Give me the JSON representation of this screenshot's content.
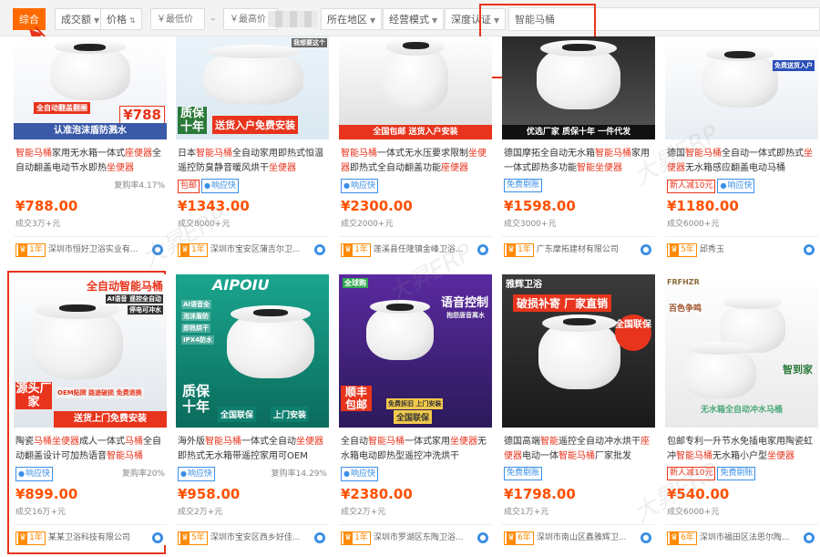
{
  "filters": {
    "sort_default": "综合",
    "sort_volume": "成交额",
    "sort_price": "价格",
    "price_min_placeholder": "￥最低价",
    "price_max_placeholder": "￥最高价",
    "region": "所在地区",
    "business_mode": "经营模式",
    "deep_verify": "深度认证",
    "search_value": "智能马桶"
  },
  "watermark": "大昇ERP",
  "colors": {
    "accent": "#ff6a00",
    "price": "#ff5000",
    "highlight_red": "#e8341c",
    "tag_blue": "#3a8ee6"
  },
  "thumbnail_text": {
    "c1": {
      "banner": "全自动翻盖翻圈",
      "price": "¥788",
      "bottom": "认准泡沫盾防溅水"
    },
    "c2": {
      "corner": "我想要这个",
      "left": "质保十年",
      "right": "送货入户免费安装"
    },
    "c3": {
      "bottom": "全国包邮 送货入户安装"
    },
    "c4": {
      "bottom": "优选厂家 质保十年 一件代发"
    },
    "c5": {
      "bottom": "免费送货入户"
    },
    "c6": {
      "top": "全自动智能马桶",
      "f1": "AI语音 遥控全自动",
      "f2": "停电可冲水",
      "left": "源头厂家",
      "strip": "OEM贴牌 路途破损 免费退换",
      "bottom": "送货上门免费安装"
    },
    "c7": {
      "brand": "AIPOIU",
      "f1": "AI语音全",
      "f2": "泡沫盾防",
      "f3": "即热烘干",
      "f4": "IPX4防水",
      "left": "质保十年",
      "b1": "全国联保",
      "b2": "上门安装"
    },
    "c8": {
      "brand": "全球购",
      "title": "语音控制",
      "sub": "抱怨唐音离水",
      "left": "顺丰包邮",
      "b1": "免费拆旧 上门安装",
      "b2": "全国联保"
    },
    "c9": {
      "brand": "雅辉卫浴",
      "title": "破损补寄 厂家直销",
      "badge": "全国联保"
    },
    "c10": {
      "brand": "FRFHZR",
      "side": "百色争鸣",
      "badge": "智到家",
      "bottom": "无水箱全自动冲水马桶"
    }
  },
  "products": [
    {
      "title_parts": [
        [
          "智能马桶",
          true
        ],
        [
          "家用无水箱一体式",
          false
        ],
        [
          "座便器",
          true
        ],
        [
          "全自动翻盖电动节水即热",
          false
        ],
        [
          "坐便器",
          true
        ]
      ],
      "tags": [],
      "rate": "复购率4.17%",
      "price": "¥788.00",
      "sold": "成交3万+元",
      "years": "1年",
      "shop": "深圳市恒好卫浴实业有..."
    },
    {
      "title_parts": [
        [
          "日本",
          false
        ],
        [
          "智能马桶",
          true
        ],
        [
          "全自动家用即热式恒温遥控防臭静音暖风烘干",
          false
        ],
        [
          "坐便器",
          true
        ]
      ],
      "tags": [
        [
          "包邮",
          "red"
        ],
        [
          "响应快",
          "fast"
        ]
      ],
      "rate": "",
      "price": "¥1343.00",
      "sold": "成交8000+元",
      "years": "1年",
      "shop": "深圳市宝安区蒲吉尔卫..."
    },
    {
      "title_parts": [
        [
          "智能马桶",
          true
        ],
        [
          "一体式无水压要求限制",
          false
        ],
        [
          "坐便器",
          true
        ],
        [
          "即热式全自动翻盖功能",
          false
        ],
        [
          "座便器",
          true
        ]
      ],
      "tags": [
        [
          "响应快",
          "fast"
        ]
      ],
      "rate": "",
      "price": "¥2300.00",
      "sold": "成交2000+元",
      "years": "1年",
      "shop": "莲溪县任隆镇金峰卫浴..."
    },
    {
      "title_parts": [
        [
          "德国摩拓全自动无水箱",
          false
        ],
        [
          "智能马桶",
          true
        ],
        [
          "家用一体式即热多功能",
          false
        ],
        [
          "智能坐便器",
          true
        ]
      ],
      "tags": [
        [
          "免费剔账",
          "blue"
        ]
      ],
      "rate": "",
      "price": "¥1598.00",
      "sold": "成交3000+元",
      "years": "1年",
      "shop": "广东摩拓建材有限公司"
    },
    {
      "title_parts": [
        [
          "德国",
          false
        ],
        [
          "智能马桶",
          true
        ],
        [
          "全自动一体式即热式",
          false
        ],
        [
          "坐便器",
          true
        ],
        [
          "无水箱感应翻盖电动马桶",
          false
        ]
      ],
      "tags": [
        [
          "新人减10元",
          "red"
        ],
        [
          "响应快",
          "fast"
        ]
      ],
      "rate": "",
      "price": "¥1180.00",
      "sold": "成交6000+元",
      "years": "5年",
      "shop": "邱秀玉"
    },
    {
      "title_parts": [
        [
          "陶瓷",
          false
        ],
        [
          "马桶坐便器",
          true
        ],
        [
          "成人一体式",
          false
        ],
        [
          "马桶",
          true
        ],
        [
          "全自动翻盖设计可加热语音",
          false
        ],
        [
          "智能马桶",
          true
        ]
      ],
      "tags": [
        [
          "响应快",
          "fast"
        ]
      ],
      "rate": "复购率20%",
      "price": "¥899.00",
      "sold": "成交16万+元",
      "years": "1年",
      "shop": "某某卫浴科技有限公司"
    },
    {
      "title_parts": [
        [
          "海外版",
          false
        ],
        [
          "智能马桶",
          true
        ],
        [
          "一体式全自动",
          false
        ],
        [
          "坐便器",
          true
        ],
        [
          "即热式无水箱带遥控家用可OEM",
          false
        ]
      ],
      "tags": [
        [
          "响应快",
          "fast"
        ]
      ],
      "rate": "复购率14.29%",
      "price": "¥958.00",
      "sold": "成交2万+元",
      "years": "5年",
      "shop": "深圳市宝安区西乡好佳..."
    },
    {
      "title_parts": [
        [
          "全自动",
          false
        ],
        [
          "智能马桶",
          true
        ],
        [
          "一体式家用",
          false
        ],
        [
          "坐便器",
          true
        ],
        [
          "无水箱电动即热型遥控冲洗烘干",
          false
        ]
      ],
      "tags": [
        [
          "响应快",
          "fast"
        ]
      ],
      "rate": "",
      "price": "¥2380.00",
      "sold": "成交2万+元",
      "years": "1年",
      "shop": "深圳市罗湖区东陶卫浴..."
    },
    {
      "title_parts": [
        [
          "德国高端",
          false
        ],
        [
          "智能",
          true
        ],
        [
          "遥控全自动冲水烘干",
          false
        ],
        [
          "座便器",
          true
        ],
        [
          "电动一体",
          false
        ],
        [
          "智能马桶",
          true
        ],
        [
          "厂家批发",
          false
        ]
      ],
      "tags": [
        [
          "免费剔账",
          "blue"
        ]
      ],
      "rate": "",
      "price": "¥1798.00",
      "sold": "成交1万+元",
      "years": "6年",
      "shop": "深圳市南山区鑫雅辉卫..."
    },
    {
      "title_parts": [
        [
          "包邮专利一升节水免插电家用陶瓷虹冲",
          false
        ],
        [
          "智能马桶",
          true
        ],
        [
          "无水箱小户型",
          false
        ],
        [
          "坐便器",
          true
        ]
      ],
      "tags": [
        [
          "新人减10元",
          "red"
        ],
        [
          "免费剔账",
          "blue"
        ]
      ],
      "rate": "",
      "price": "¥540.00",
      "sold": "成交6000+元",
      "years": "6年",
      "shop": "深圳市福田区法思尔陶..."
    }
  ]
}
